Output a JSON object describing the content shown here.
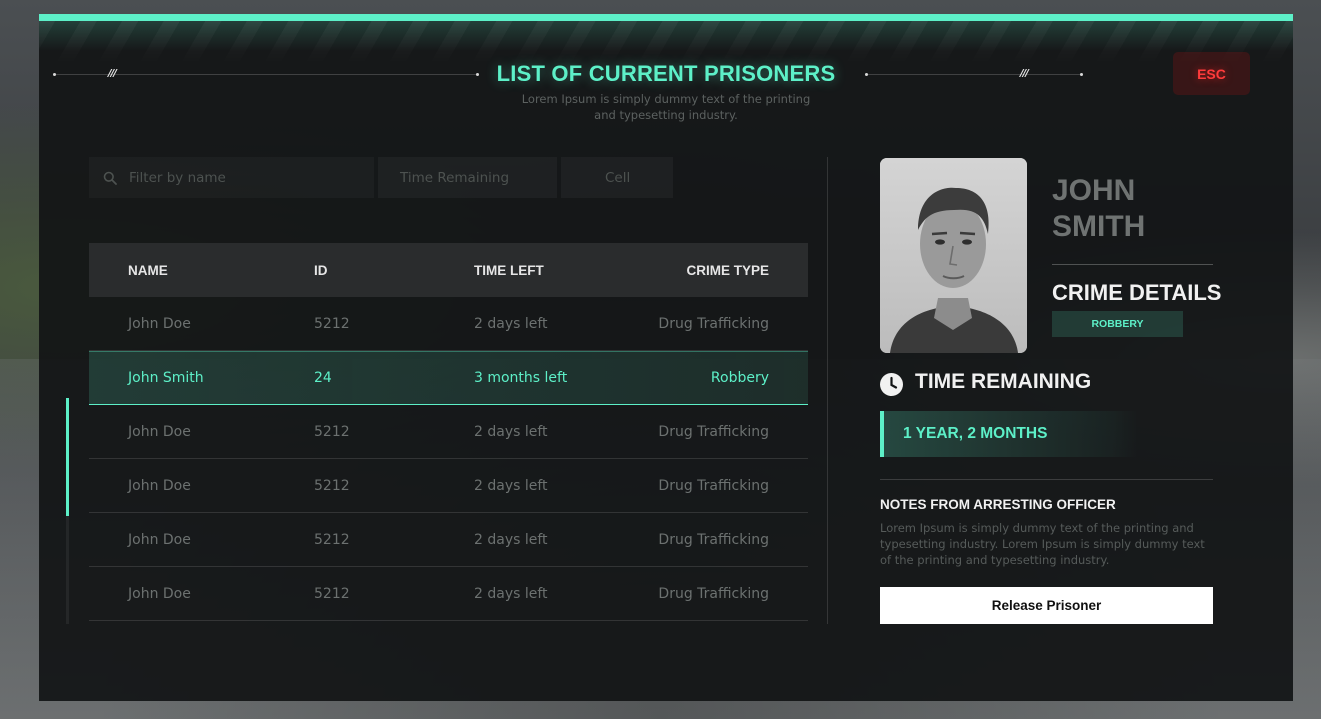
{
  "header": {
    "title": "LIST OF CURRENT PRISONERS",
    "subtitle": "Lorem Ipsum is simply dummy text of the printing and typesetting industry.",
    "esc_label": "ESC",
    "left_ornament": "///",
    "right_ornament": "///"
  },
  "filters": {
    "search_placeholder": "Filter by name",
    "time_placeholder": "Time Remaining",
    "cell_placeholder": "Cell"
  },
  "table": {
    "columns": [
      "NAME",
      "ID",
      "TIME LEFT",
      "CRIME TYPE"
    ],
    "rows": [
      {
        "name": "John Doe",
        "id": "5212",
        "time": "2 days left",
        "crime": "Drug Trafficking"
      },
      {
        "name": "John Smith",
        "id": "24",
        "time": "3 months left",
        "crime": "Robbery"
      },
      {
        "name": "John Doe",
        "id": "5212",
        "time": "2 days left",
        "crime": "Drug Trafficking"
      },
      {
        "name": "John Doe",
        "id": "5212",
        "time": "2 days left",
        "crime": "Drug Trafficking"
      },
      {
        "name": "John Doe",
        "id": "5212",
        "time": "2 days left",
        "crime": "Drug Trafficking"
      },
      {
        "name": "John Doe",
        "id": "5212",
        "time": "2 days left",
        "crime": "Drug Trafficking"
      }
    ],
    "selected_index": 1
  },
  "detail": {
    "first_name": "JOHN",
    "last_name": "SMITH",
    "crime_title": "CRIME DETAILS",
    "crime_badge": "ROBBERY",
    "time_title": "TIME REMAINING",
    "time_value": "1 YEAR, 2 MONTHS",
    "notes_title": "NOTES FROM ARRESTING OFFICER",
    "notes_text": "Lorem Ipsum is simply dummy text of the printing and typesetting industry. Lorem Ipsum is simply dummy text of the printing and typesetting industry.",
    "release_label": "Release Prisoner"
  },
  "colors": {
    "accent": "#5df0c8",
    "esc": "#ff3b3b",
    "panel": "#121415"
  },
  "icons": {
    "search": "search-icon",
    "clock": "clock-icon"
  }
}
